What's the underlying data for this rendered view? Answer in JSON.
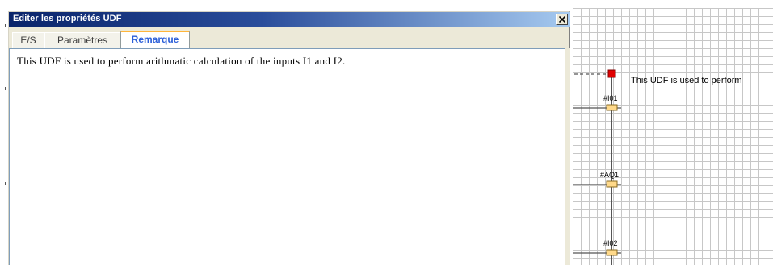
{
  "dialog": {
    "title": "Editer les propriétés UDF",
    "close_label": "X",
    "tabs": [
      {
        "label": "E/S",
        "active": false
      },
      {
        "label": "Paramètres",
        "active": false
      },
      {
        "label": "Remarque",
        "active": true
      }
    ],
    "remark_text": "This UDF is used to perform arithmatic calculation of the inputs I1 and I2."
  },
  "canvas": {
    "remark_label": "This UDF is used to perform",
    "pins": [
      {
        "label": "#I01"
      },
      {
        "label": "#AQ1"
      },
      {
        "label": "#I02"
      }
    ]
  },
  "colors": {
    "titlebar_start": "#0a246a",
    "titlebar_end": "#a6caf0",
    "active_tab_text": "#2b5fd9",
    "active_tab_accent": "#ffb53b",
    "pin_fill": "#ffd98a",
    "terminal_red": "#e00000",
    "grid_line": "#c7c7c7"
  }
}
